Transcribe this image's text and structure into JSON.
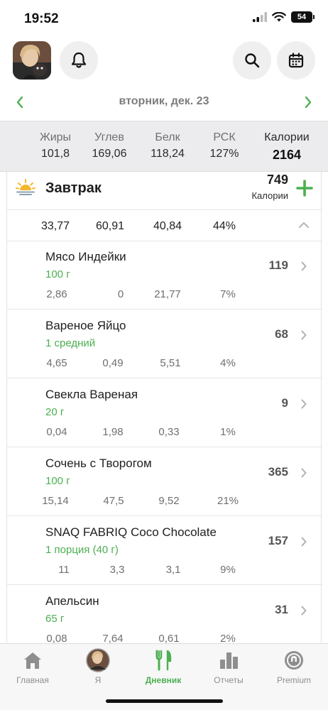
{
  "status": {
    "time": "19:52",
    "battery": "54"
  },
  "date": {
    "label": "вторник, дек. 23"
  },
  "summary": {
    "columns": [
      {
        "label": "Жиры",
        "value": "101,8"
      },
      {
        "label": "Углев",
        "value": "169,06"
      },
      {
        "label": "Белк",
        "value": "118,24"
      },
      {
        "label": "РСК",
        "value": "127%"
      },
      {
        "label": "Калории",
        "value": "2164"
      }
    ]
  },
  "meal": {
    "title": "Завтрак",
    "calories": "749",
    "calories_label": "Калории",
    "macros": [
      "33,77",
      "60,91",
      "40,84",
      "44%"
    ]
  },
  "foods": [
    {
      "name": "Мясо Индейки",
      "portion": "100 г",
      "calories": "119",
      "macros": [
        "2,86",
        "0",
        "21,77",
        "7%"
      ]
    },
    {
      "name": "Вареное Яйцо",
      "portion": "1 средний",
      "calories": "68",
      "macros": [
        "4,65",
        "0,49",
        "5,51",
        "4%"
      ]
    },
    {
      "name": "Свекла Вареная",
      "portion": "20 г",
      "calories": "9",
      "macros": [
        "0,04",
        "1,98",
        "0,33",
        "1%"
      ]
    },
    {
      "name": "Сочень с Творогом",
      "portion": "100 г",
      "calories": "365",
      "macros": [
        "15,14",
        "47,5",
        "9,52",
        "21%"
      ]
    },
    {
      "name": "SNAQ FABRIQ Coco Chocolate",
      "portion": "1 порция (40 г)",
      "calories": "157",
      "macros": [
        "11",
        "3,3",
        "3,1",
        "9%"
      ]
    },
    {
      "name": "Апельсин",
      "portion": "65 г",
      "calories": "31",
      "macros": [
        "0,08",
        "7,64",
        "0,61",
        "2%"
      ]
    }
  ],
  "tabs": [
    {
      "label": "Главная",
      "icon": "home-icon",
      "active": false
    },
    {
      "label": "Я",
      "icon": "profile-avatar-icon",
      "active": false
    },
    {
      "label": "Дневник",
      "icon": "fork-knife-icon",
      "active": true
    },
    {
      "label": "Отчеты",
      "icon": "bar-chart-icon",
      "active": false
    },
    {
      "label": "Premium",
      "icon": "premium-badge-icon",
      "active": false
    }
  ],
  "colors": {
    "accent": "#4caf50",
    "summary_bg": "#ececef"
  }
}
